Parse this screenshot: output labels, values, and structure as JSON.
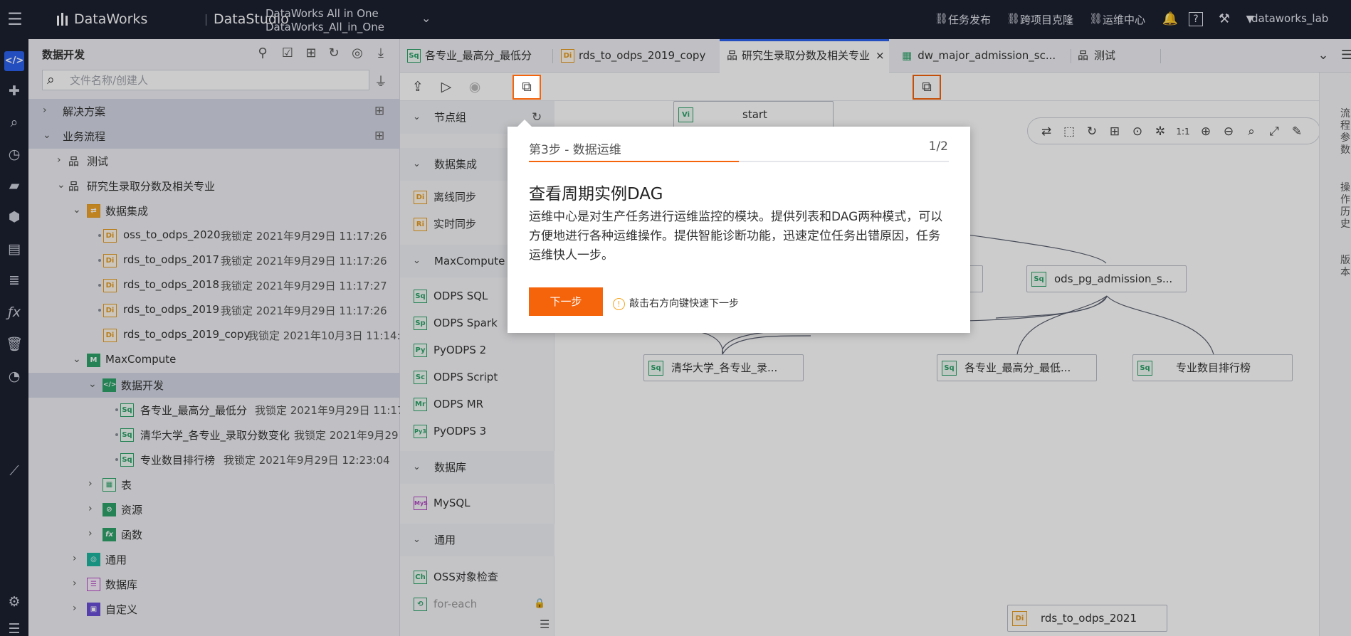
{
  "topbar": {
    "app": "DataWorks",
    "module": "DataStudio",
    "workspace_line1": "DataWorks All in One",
    "workspace_line2": "DataWorks_All_in_One",
    "links": [
      "任务发布",
      "跨项目克隆",
      "运维中心"
    ],
    "user": "dataworks_lab"
  },
  "tree": {
    "title": "数据开发",
    "search_placeholder": "文件名称/创建人",
    "rows": [
      {
        "label": "解决方案",
        "meta": ""
      },
      {
        "label": "业务流程",
        "meta": ""
      },
      {
        "label": "测试",
        "meta": ""
      },
      {
        "label": "研究生录取分数及相关专业",
        "meta": ""
      },
      {
        "label": "数据集成",
        "meta": ""
      },
      {
        "label": "oss_to_odps_2020",
        "meta": "我锁定   2021年9月29日 11:17:26"
      },
      {
        "label": "rds_to_odps_2017",
        "meta": "我锁定   2021年9月29日 11:17:26"
      },
      {
        "label": "rds_to_odps_2018",
        "meta": "我锁定   2021年9月29日 11:17:27"
      },
      {
        "label": "rds_to_odps_2019",
        "meta": "我锁定   2021年9月29日 11:17:26"
      },
      {
        "label": "rds_to_odps_2019_copy",
        "meta": "我锁定   2021年10月3日 11:14:2"
      },
      {
        "label": "MaxCompute",
        "meta": ""
      },
      {
        "label": "数据开发",
        "meta": ""
      },
      {
        "label": "各专业_最高分_最低分",
        "meta": "我锁定   2021年9月29日 11:17:"
      },
      {
        "label": "清华大学_各专业_录取分数变化",
        "meta": "我锁定   2021年9月29"
      },
      {
        "label": "专业数目排行榜",
        "meta": "我锁定   2021年9月29日 12:23:04"
      },
      {
        "label": "表",
        "meta": ""
      },
      {
        "label": "资源",
        "meta": ""
      },
      {
        "label": "函数",
        "meta": ""
      },
      {
        "label": "通用",
        "meta": ""
      },
      {
        "label": "数据库",
        "meta": ""
      },
      {
        "label": "自定义",
        "meta": ""
      }
    ]
  },
  "tabs": [
    {
      "label": "各专业_最高分_最低分",
      "badge": "Sq"
    },
    {
      "label": "rds_to_odps_2019_copy",
      "badge": "Di"
    },
    {
      "label": "研究生录取分数及相关专业",
      "badge": ""
    },
    {
      "label": "dw_major_admission_sc...",
      "badge": ""
    },
    {
      "label": "测试",
      "badge": ""
    }
  ],
  "palette": {
    "sections": [
      "节点组",
      "数据集成",
      "MaxCompute",
      "数据库",
      "通用"
    ],
    "items": [
      {
        "badge": "Di",
        "label": "离线同步"
      },
      {
        "badge": "Ri",
        "label": "实时同步"
      },
      {
        "badge": "Sq",
        "label": "ODPS SQL"
      },
      {
        "badge": "Sp",
        "label": "ODPS Spark"
      },
      {
        "badge": "Py",
        "label": "PyODPS 2"
      },
      {
        "badge": "Sc",
        "label": "ODPS Script"
      },
      {
        "badge": "Mr",
        "label": "ODPS MR"
      },
      {
        "badge": "Py3",
        "label": "PyODPS 3"
      },
      {
        "badge": "MyS",
        "label": "MySQL"
      },
      {
        "badge": "Ch",
        "label": "OSS对象检查"
      },
      {
        "badge": "",
        "label": "for-each"
      }
    ]
  },
  "canvas": {
    "nodes": [
      {
        "badge": "Vi",
        "label": "start"
      },
      {
        "badge": "Sq",
        "label": "ods_pg_admission_s..."
      },
      {
        "badge": "Sq",
        "label": "清华大学_各专业_录..."
      },
      {
        "badge": "Sq",
        "label": "各专业_最高分_最低..."
      },
      {
        "badge": "Sq",
        "label": "专业数目排行榜"
      },
      {
        "badge": "Di",
        "label": "rds_to_odps_2021"
      }
    ]
  },
  "right_panel": [
    "流程参数",
    "操作历史",
    "版本"
  ],
  "popup": {
    "step": "第3步 - 数据运维",
    "pager": "1/2",
    "progress": 0.5,
    "title": "查看周期实例DAG",
    "desc": "运维中心是对生产任务进行运维监控的模块。提供列表和DAG两种模式，可以方便地进行各种运维操作。提供智能诊断功能，迅速定位任务出错原因，任务运维快人一步。",
    "next": "下一步",
    "hint": "敲击右方向键快速下一步"
  },
  "colors": {
    "accent": "#f5630b",
    "primary": "#2b62f0",
    "nav_bg": "#1c2131"
  }
}
